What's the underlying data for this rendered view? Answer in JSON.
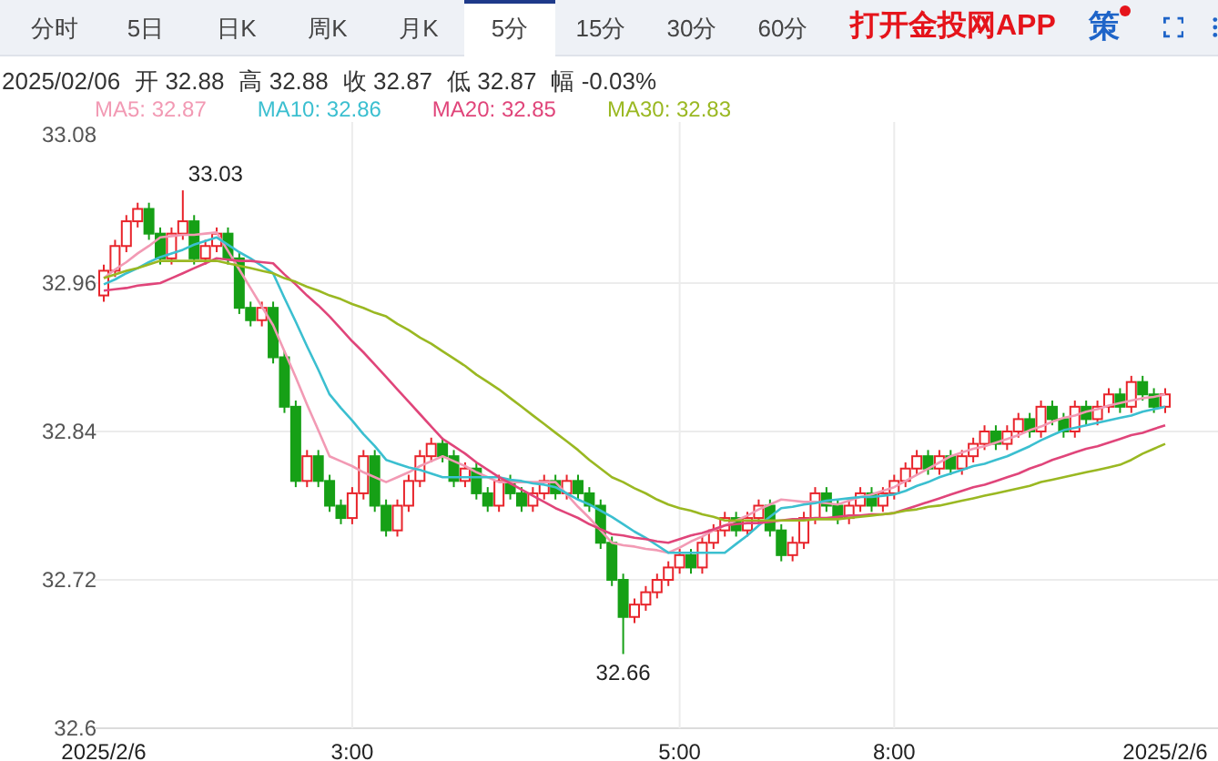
{
  "tabs": [
    {
      "label": "分时",
      "selected": false
    },
    {
      "label": "5日",
      "selected": false
    },
    {
      "label": "日K",
      "selected": false
    },
    {
      "label": "周K",
      "selected": false
    },
    {
      "label": "月K",
      "selected": false
    },
    {
      "label": "5分",
      "selected": true
    },
    {
      "label": "15分",
      "selected": false
    },
    {
      "label": "30分",
      "selected": false
    },
    {
      "label": "60分",
      "selected": false
    }
  ],
  "app_link": "打开金投网APP",
  "strategy_button": {
    "label": "策",
    "notification": true
  },
  "quote": {
    "date": "2025/02/06",
    "fields": [
      {
        "label": "开",
        "value": "32.88"
      },
      {
        "label": "高",
        "value": "32.88"
      },
      {
        "label": "收",
        "value": "32.87"
      },
      {
        "label": "低",
        "value": "32.87"
      },
      {
        "label": "幅",
        "value": "-0.03%"
      }
    ]
  },
  "chart_data": {
    "type": "candlestick",
    "grid": true,
    "ylim": [
      32.6,
      33.08
    ],
    "yticks": [
      {
        "value": 33.08,
        "label": "33.08"
      },
      {
        "value": 32.96,
        "label": "32.96"
      },
      {
        "value": 32.84,
        "label": "32.84"
      },
      {
        "value": 32.72,
        "label": "32.72"
      },
      {
        "value": 32.6,
        "label": "32.6"
      }
    ],
    "categories": [
      "2025/2/6",
      null,
      null,
      null,
      null,
      null,
      null,
      null,
      null,
      null,
      null,
      null,
      null,
      null,
      null,
      null,
      null,
      null,
      null,
      null,
      null,
      null,
      "3:00",
      null,
      null,
      null,
      null,
      null,
      null,
      null,
      null,
      null,
      null,
      null,
      null,
      null,
      null,
      null,
      null,
      null,
      null,
      null,
      null,
      null,
      null,
      null,
      null,
      null,
      null,
      null,
      null,
      "5:00",
      null,
      null,
      null,
      null,
      null,
      null,
      null,
      null,
      null,
      null,
      null,
      null,
      null,
      null,
      null,
      null,
      null,
      null,
      "8:00",
      null,
      null,
      null,
      null,
      null,
      null,
      null,
      null,
      null,
      null,
      null,
      null,
      null,
      null,
      null,
      null,
      null,
      null,
      null,
      null,
      null,
      null,
      null,
      "2025/2/6"
    ],
    "ohlc": [
      [
        32.95,
        32.975,
        32.945,
        32.97
      ],
      [
        32.97,
        32.995,
        32.965,
        32.99
      ],
      [
        32.99,
        33.015,
        32.985,
        33.01
      ],
      [
        33.01,
        33.025,
        33.005,
        33.02
      ],
      [
        33.02,
        33.025,
        32.995,
        33.0
      ],
      [
        33.0,
        33.005,
        32.975,
        32.98
      ],
      [
        32.98,
        33.005,
        32.975,
        33.0
      ],
      [
        33.0,
        33.035,
        32.995,
        33.01
      ],
      [
        33.01,
        33.015,
        32.975,
        32.98
      ],
      [
        32.98,
        32.995,
        32.975,
        32.99
      ],
      [
        32.99,
        33.005,
        32.985,
        33.0
      ],
      [
        33.0,
        33.005,
        32.975,
        32.98
      ],
      [
        32.98,
        32.985,
        32.935,
        32.94
      ],
      [
        32.94,
        32.945,
        32.925,
        32.93
      ],
      [
        32.93,
        32.945,
        32.925,
        32.94
      ],
      [
        32.94,
        32.945,
        32.895,
        32.9
      ],
      [
        32.9,
        32.905,
        32.855,
        32.86
      ],
      [
        32.86,
        32.865,
        32.795,
        32.8
      ],
      [
        32.8,
        32.825,
        32.795,
        32.82
      ],
      [
        32.82,
        32.825,
        32.795,
        32.8
      ],
      [
        32.8,
        32.805,
        32.775,
        32.78
      ],
      [
        32.78,
        32.785,
        32.765,
        32.77
      ],
      [
        32.77,
        32.795,
        32.765,
        32.79
      ],
      [
        32.79,
        32.825,
        32.785,
        32.82
      ],
      [
        32.82,
        32.825,
        32.775,
        32.78
      ],
      [
        32.78,
        32.785,
        32.755,
        32.76
      ],
      [
        32.76,
        32.785,
        32.755,
        32.78
      ],
      [
        32.78,
        32.805,
        32.775,
        32.8
      ],
      [
        32.8,
        32.825,
        32.795,
        32.82
      ],
      [
        32.82,
        32.835,
        32.815,
        32.83
      ],
      [
        32.83,
        32.835,
        32.815,
        32.82
      ],
      [
        32.82,
        32.825,
        32.795,
        32.8
      ],
      [
        32.8,
        32.815,
        32.795,
        32.81
      ],
      [
        32.81,
        32.815,
        32.785,
        32.79
      ],
      [
        32.79,
        32.795,
        32.775,
        32.78
      ],
      [
        32.78,
        32.805,
        32.775,
        32.8
      ],
      [
        32.8,
        32.805,
        32.785,
        32.79
      ],
      [
        32.79,
        32.795,
        32.775,
        32.78
      ],
      [
        32.78,
        32.795,
        32.775,
        32.79
      ],
      [
        32.79,
        32.805,
        32.785,
        32.8
      ],
      [
        32.8,
        32.805,
        32.785,
        32.79
      ],
      [
        32.79,
        32.805,
        32.785,
        32.8
      ],
      [
        32.8,
        32.805,
        32.785,
        32.79
      ],
      [
        32.79,
        32.795,
        32.775,
        32.78
      ],
      [
        32.78,
        32.785,
        32.745,
        32.75
      ],
      [
        32.75,
        32.755,
        32.715,
        32.72
      ],
      [
        32.72,
        32.725,
        32.66,
        32.69
      ],
      [
        32.69,
        32.705,
        32.685,
        32.7
      ],
      [
        32.7,
        32.715,
        32.695,
        32.71
      ],
      [
        32.71,
        32.725,
        32.705,
        32.72
      ],
      [
        32.72,
        32.735,
        32.715,
        32.73
      ],
      [
        32.73,
        32.745,
        32.725,
        32.74
      ],
      [
        32.74,
        32.745,
        32.725,
        32.73
      ],
      [
        32.73,
        32.755,
        32.725,
        32.75
      ],
      [
        32.75,
        32.765,
        32.745,
        32.76
      ],
      [
        32.76,
        32.775,
        32.755,
        32.77
      ],
      [
        32.77,
        32.775,
        32.755,
        32.76
      ],
      [
        32.76,
        32.775,
        32.755,
        32.77
      ],
      [
        32.77,
        32.785,
        32.765,
        32.78
      ],
      [
        32.78,
        32.785,
        32.755,
        32.76
      ],
      [
        32.76,
        32.765,
        32.735,
        32.74
      ],
      [
        32.74,
        32.755,
        32.735,
        32.75
      ],
      [
        32.75,
        32.775,
        32.745,
        32.77
      ],
      [
        32.77,
        32.795,
        32.765,
        32.79
      ],
      [
        32.79,
        32.795,
        32.775,
        32.78
      ],
      [
        32.78,
        32.785,
        32.765,
        32.77
      ],
      [
        32.77,
        32.785,
        32.765,
        32.78
      ],
      [
        32.78,
        32.795,
        32.775,
        32.79
      ],
      [
        32.79,
        32.795,
        32.775,
        32.78
      ],
      [
        32.78,
        32.795,
        32.775,
        32.79
      ],
      [
        32.79,
        32.805,
        32.785,
        32.8
      ],
      [
        32.8,
        32.815,
        32.795,
        32.81
      ],
      [
        32.81,
        32.825,
        32.805,
        32.82
      ],
      [
        32.82,
        32.825,
        32.805,
        32.81
      ],
      [
        32.81,
        32.825,
        32.805,
        32.82
      ],
      [
        32.82,
        32.825,
        32.805,
        32.81
      ],
      [
        32.81,
        32.825,
        32.805,
        32.82
      ],
      [
        32.82,
        32.835,
        32.815,
        32.83
      ],
      [
        32.83,
        32.845,
        32.825,
        32.84
      ],
      [
        32.84,
        32.845,
        32.825,
        32.83
      ],
      [
        32.83,
        32.845,
        32.825,
        32.84
      ],
      [
        32.84,
        32.855,
        32.835,
        32.85
      ],
      [
        32.85,
        32.855,
        32.835,
        32.84
      ],
      [
        32.84,
        32.865,
        32.835,
        32.86
      ],
      [
        32.86,
        32.865,
        32.845,
        32.85
      ],
      [
        32.85,
        32.855,
        32.835,
        32.84
      ],
      [
        32.84,
        32.865,
        32.835,
        32.86
      ],
      [
        32.86,
        32.865,
        32.845,
        32.85
      ],
      [
        32.85,
        32.865,
        32.845,
        32.86
      ],
      [
        32.86,
        32.875,
        32.855,
        32.87
      ],
      [
        32.87,
        32.875,
        32.855,
        32.86
      ],
      [
        32.86,
        32.885,
        32.855,
        32.88
      ],
      [
        32.88,
        32.885,
        32.865,
        32.87
      ],
      [
        32.87,
        32.875,
        32.855,
        32.86
      ],
      [
        32.86,
        32.875,
        32.855,
        32.87
      ]
    ],
    "series": [
      {
        "name": "MA5: 32.87",
        "type": "line",
        "color": "#f29ab4",
        "values": [
          32.964,
          32.971,
          32.977,
          32.984,
          32.99,
          32.997,
          32.998,
          32.999,
          32.999,
          33.0,
          33.001,
          32.986,
          32.971,
          32.956,
          32.941,
          32.926,
          32.905,
          32.884,
          32.862,
          32.841,
          32.82,
          32.816,
          32.812,
          32.807,
          32.803,
          32.799,
          32.803,
          32.807,
          32.812,
          32.816,
          32.82,
          32.816,
          32.812,
          32.807,
          32.803,
          32.799,
          32.799,
          32.799,
          32.799,
          32.799,
          32.799,
          32.789,
          32.779,
          32.77,
          32.76,
          32.75,
          32.748,
          32.747,
          32.745,
          32.744,
          32.742,
          32.746,
          32.751,
          32.755,
          32.76,
          32.764,
          32.768,
          32.772,
          32.777,
          32.781,
          32.785,
          32.784,
          32.783,
          32.783,
          32.782,
          32.781,
          32.784,
          32.787,
          32.789,
          32.792,
          32.795,
          32.8,
          32.805,
          32.81,
          32.815,
          32.82,
          32.823,
          32.826,
          32.828,
          32.831,
          32.834,
          32.837,
          32.841,
          32.844,
          32.848,
          32.851,
          32.853,
          32.856,
          32.858,
          32.861,
          32.863,
          32.865,
          32.867,
          32.868,
          32.87
        ]
      },
      {
        "name": "MA10: 32.86",
        "type": "line",
        "color": "#3bbfd0",
        "values": [
          32.959,
          32.963,
          32.968,
          32.972,
          32.977,
          32.981,
          32.984,
          32.987,
          32.991,
          32.994,
          32.997,
          32.991,
          32.985,
          32.98,
          32.974,
          32.968,
          32.948,
          32.929,
          32.909,
          32.89,
          32.87,
          32.859,
          32.849,
          32.838,
          32.828,
          32.817,
          32.814,
          32.811,
          32.809,
          32.806,
          32.803,
          32.803,
          32.803,
          32.803,
          32.803,
          32.803,
          32.801,
          32.8,
          32.798,
          32.797,
          32.795,
          32.79,
          32.785,
          32.781,
          32.776,
          32.771,
          32.765,
          32.759,
          32.754,
          32.748,
          32.742,
          32.742,
          32.742,
          32.742,
          32.742,
          32.742,
          32.749,
          32.756,
          32.764,
          32.771,
          32.778,
          32.779,
          32.781,
          32.782,
          32.784,
          32.785,
          32.786,
          32.787,
          32.787,
          32.788,
          32.789,
          32.792,
          32.796,
          32.799,
          32.803,
          32.806,
          32.809,
          32.812,
          32.814,
          32.817,
          32.82,
          32.824,
          32.828,
          32.833,
          32.837,
          32.841,
          32.843,
          32.845,
          32.847,
          32.849,
          32.851,
          32.853,
          32.856,
          32.858,
          32.86
        ]
      },
      {
        "name": "MA20: 32.85",
        "type": "line",
        "color": "#e0457a",
        "values": [
          32.954,
          32.955,
          32.956,
          32.958,
          32.959,
          32.96,
          32.964,
          32.968,
          32.972,
          32.976,
          32.98,
          32.979,
          32.978,
          32.978,
          32.977,
          32.976,
          32.967,
          32.959,
          32.95,
          32.942,
          32.933,
          32.923,
          32.913,
          32.904,
          32.894,
          32.884,
          32.874,
          32.864,
          32.854,
          32.844,
          32.834,
          32.828,
          32.822,
          32.815,
          32.809,
          32.803,
          32.798,
          32.793,
          32.788,
          32.783,
          32.778,
          32.774,
          32.77,
          32.765,
          32.761,
          32.757,
          32.756,
          32.754,
          32.753,
          32.751,
          32.75,
          32.753,
          32.756,
          32.758,
          32.761,
          32.764,
          32.765,
          32.766,
          32.766,
          32.767,
          32.768,
          32.769,
          32.769,
          32.77,
          32.77,
          32.771,
          32.772,
          32.772,
          32.773,
          32.773,
          32.774,
          32.777,
          32.78,
          32.783,
          32.786,
          32.789,
          32.792,
          32.795,
          32.797,
          32.8,
          32.803,
          32.806,
          32.81,
          32.813,
          32.817,
          32.82,
          32.823,
          32.826,
          32.828,
          32.831,
          32.834,
          32.837,
          32.839,
          32.842,
          32.845
        ]
      },
      {
        "name": "MA30: 32.83",
        "type": "line",
        "color": "#9ab822",
        "values": [
          32.964,
          32.967,
          32.97,
          32.972,
          32.975,
          32.978,
          32.978,
          32.978,
          32.978,
          32.978,
          32.978,
          32.976,
          32.974,
          32.972,
          32.97,
          32.968,
          32.964,
          32.961,
          32.957,
          32.954,
          32.95,
          32.947,
          32.943,
          32.94,
          32.936,
          32.933,
          32.927,
          32.922,
          32.916,
          32.911,
          32.905,
          32.899,
          32.893,
          32.886,
          32.88,
          32.874,
          32.867,
          32.86,
          32.853,
          32.846,
          32.839,
          32.832,
          32.825,
          32.817,
          32.81,
          32.803,
          32.799,
          32.794,
          32.79,
          32.785,
          32.781,
          32.778,
          32.776,
          32.773,
          32.771,
          32.768,
          32.768,
          32.768,
          32.768,
          32.768,
          32.768,
          32.768,
          32.768,
          32.769,
          32.769,
          32.769,
          32.77,
          32.771,
          32.772,
          32.773,
          32.774,
          32.776,
          32.777,
          32.779,
          32.78,
          32.782,
          32.784,
          32.786,
          32.788,
          32.79,
          32.792,
          32.794,
          32.796,
          32.799,
          32.801,
          32.803,
          32.805,
          32.807,
          32.809,
          32.811,
          32.813,
          32.817,
          32.822,
          32.826,
          32.83
        ]
      }
    ],
    "annotations": [
      "33.03",
      "32.66"
    ]
  }
}
